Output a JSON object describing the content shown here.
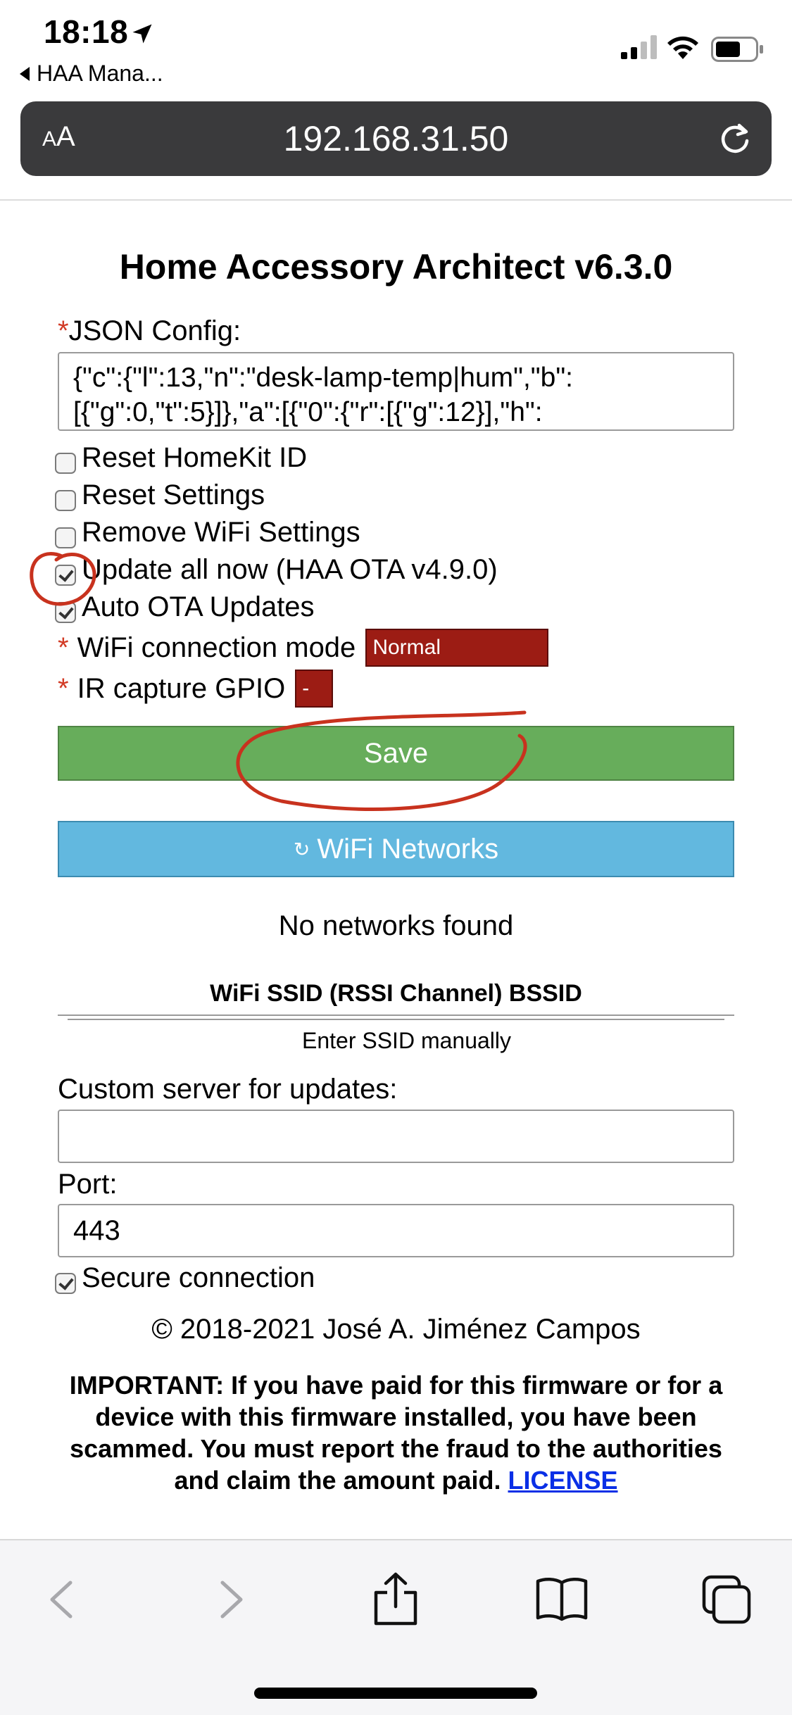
{
  "status_bar": {
    "time": "18:18",
    "back_app": "HAA Mana..."
  },
  "browser": {
    "aa_label_small": "A",
    "aa_label_big": "A",
    "url": "192.168.31.50"
  },
  "page": {
    "title": "Home Accessory Architect v6.3.0",
    "required_mark": "*",
    "json_label": "JSON Config:",
    "json_value_line1": "{\"c\":{\"l\":13,\"n\":\"desk-lamp-temp|hum\",\"b\":",
    "json_value_line2": "[{\"g\":0,\"t\":5}]},\"a\":[{\"0\":{\"r\":[{\"g\":12}],\"h\":",
    "checkboxes": [
      {
        "label": "Reset HomeKit ID",
        "checked": false
      },
      {
        "label": "Reset Settings",
        "checked": false
      },
      {
        "label": "Remove WiFi Settings",
        "checked": false
      },
      {
        "label": "Update all now (HAA OTA v4.9.0)",
        "checked": true
      },
      {
        "label": "Auto OTA Updates",
        "checked": true
      }
    ],
    "wifi_mode_label": "WiFi connection mode",
    "wifi_mode_value": "Normal",
    "ir_label": "IR capture GPIO",
    "ir_value": "-",
    "save_label": "Save",
    "wifi_networks_icon": "↻",
    "wifi_networks_label": "WiFi Networks",
    "no_networks": "No networks found",
    "wifi_table_header": "WiFi SSID (RSSI Channel) BSSID",
    "manual_ssid": "Enter SSID manually",
    "custom_server_label": "Custom server for updates:",
    "custom_server_value": "",
    "port_label": "Port:",
    "port_value": "443",
    "secure_label": "Secure connection",
    "secure_checked": true,
    "copyright": "© 2018-2021 José A. Jiménez Campos",
    "important_bold": "IMPORTANT:",
    "important_text": " If you have paid for this firmware or for a device with this firmware installed, you have been scammed. You must report the fraud to the authorities and claim the amount paid. ",
    "license_link": "LICENSE"
  },
  "colors": {
    "save": "#67ad5b",
    "wifi_button": "#62b8df",
    "select": "#9c1c14",
    "required": "#d23b26",
    "annotation": "#c8321e",
    "link": "#0a2fe6"
  },
  "icons": [
    "location-arrow-icon",
    "signal-icon",
    "wifi-icon",
    "battery-icon",
    "reload-icon",
    "back-icon",
    "forward-icon",
    "share-icon",
    "bookmarks-icon",
    "tabs-icon"
  ]
}
